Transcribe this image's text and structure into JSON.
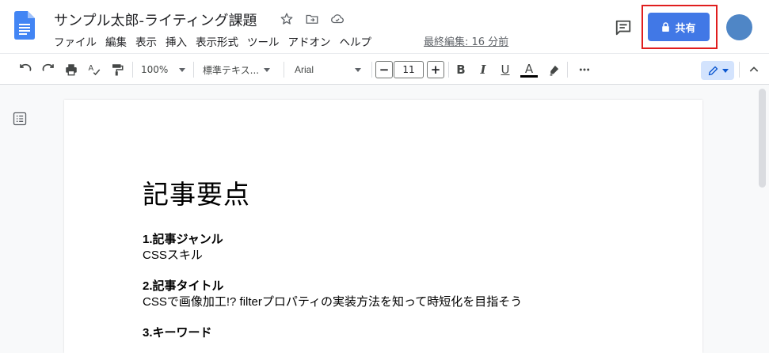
{
  "header": {
    "title": "サンプル太郎-ライティング課題",
    "menu": [
      "ファイル",
      "編集",
      "表示",
      "挿入",
      "表示形式",
      "ツール",
      "アドオン",
      "ヘルプ"
    ],
    "last_edit": "最終編集: 16 分前",
    "share_label": "共有",
    "colors": {
      "share": "#4178e6",
      "highlight": "#e01e1e",
      "avatar": "#4f86c6",
      "docs_blue": "#4285f4"
    }
  },
  "toolbar": {
    "zoom": "100%",
    "style": "標準テキス...",
    "font": "Arial",
    "font_size": "11",
    "minus": "−",
    "plus": "+",
    "bold": "B",
    "italic": "I",
    "underline": "U",
    "text_color": "A"
  },
  "document": {
    "heading": "記事要点",
    "sections": [
      {
        "title": "1.記事ジャンル",
        "body": "CSSスキル"
      },
      {
        "title": "2.記事タイトル",
        "body": "CSSで画像加工!? filterプロパティの実装方法を知って時短化を目指そう"
      },
      {
        "title": "3.キーワード",
        "body": ""
      }
    ]
  }
}
